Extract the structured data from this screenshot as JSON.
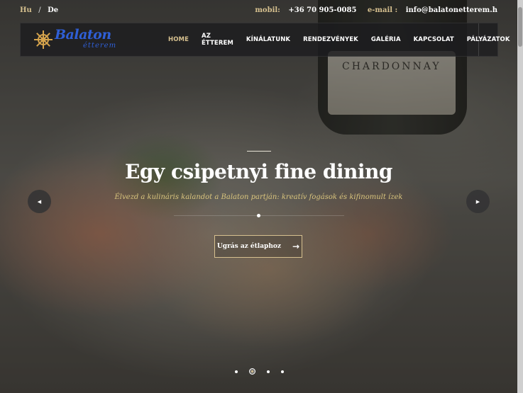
{
  "topbar": {
    "lang_hu": "Hu",
    "lang_sep": "/",
    "lang_de": "De",
    "mobile_label": "mobil:",
    "mobile_value": "+36 70 905-0085",
    "email_label": "e-mail :",
    "email_value": "info@balatonetterem.h"
  },
  "logo": {
    "name": "Balaton",
    "subtitle": "étterem"
  },
  "nav": {
    "items": [
      {
        "label": "HOME",
        "active": true
      },
      {
        "label": "AZ ÉTTEREM"
      },
      {
        "label": "KÍNÁLATUNK"
      },
      {
        "label": "RENDEZVÉNYEK"
      },
      {
        "label": "GALÉRIA"
      },
      {
        "label": "KAPCSOLAT"
      },
      {
        "label": "PÁLYÁZATOK"
      }
    ]
  },
  "hero": {
    "title": "Egy csipetnyi fine dining",
    "subtitle": "Élvezd a kulináris kalandot a Balaton partján: kreatív fogások és kifinomult ízek",
    "cta_label": "Ugrás az étlaphoz",
    "cta_arrow": "→",
    "bottle_label": "CHARDONNAY",
    "prev_icon": "◀",
    "next_icon": "▶",
    "active_slide": 2,
    "slide_count": 4
  },
  "colors": {
    "accent_gold": "#d6c08f",
    "logo_blue": "#2f5fd6"
  }
}
